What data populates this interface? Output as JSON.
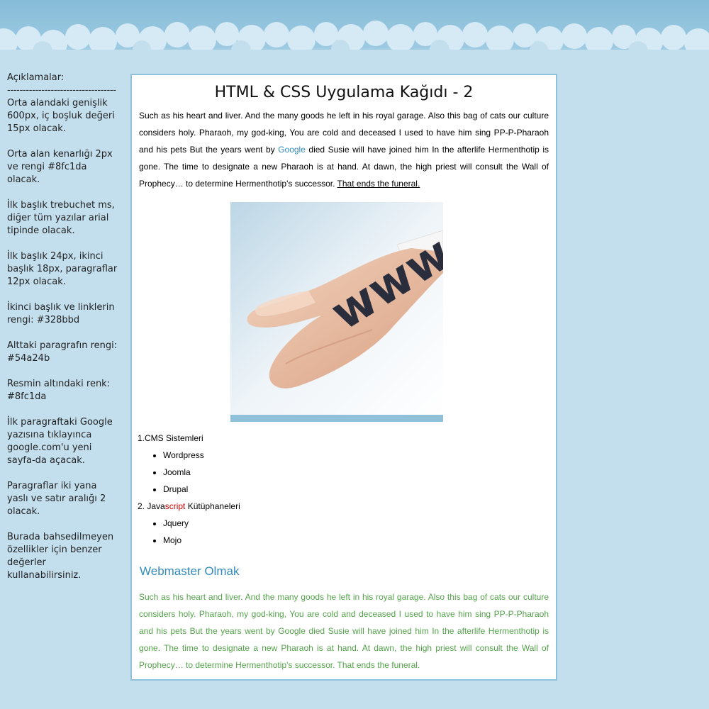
{
  "sidebar": {
    "heading": "Açıklamalar:",
    "divider": "-----------------------------------",
    "notes": [
      "Orta alandaki genişlik 600px, iç boşluk değeri 15px olacak.",
      "Orta alan kenarlığı 2px ve rengi #8fc1da olacak.",
      "İlk başlık trebuchet ms, diğer tüm yazılar arial tipinde olacak.",
      "İlk başlık 24px, ikinci başlık 18px, paragraflar 12px olacak.",
      "İkinci başlık ve linklerin rengi: #328bbd",
      "Alttaki paragrafın rengi: #54a24b",
      "Resmin altındaki renk: #8fc1da",
      "İlk paragraftaki Google yazısına tıklayınca google.com'u yeni sayfa-da açacak.",
      "Paragraflar iki yana yaslı ve satır aralığı 2 olacak.",
      "Burada bahsedilmeyen özellikler için benzer değerler kullanabilirsiniz."
    ]
  },
  "main": {
    "title": "HTML & CSS Uygulama Kağıdı - 2",
    "para1": {
      "text_a": "Such as his heart and liver. And the many goods he left in his royal garage. Also this bag of cats our culture considers holy. Pharaoh, my god-king, You are cold and deceased I used to have him sing PP-P-Pharaoh and his pets But the years went by ",
      "link_google": "Google",
      "text_b": " died Susie will have joined him In the afterlife Hermenthotip is gone. The time to designate a new Pharaoh is at hand. At dawn, the high priest will consult the Wall of Prophecy… to determine Hermenthotip's successor. ",
      "link_end": "That ends the funeral."
    },
    "image_text": "www",
    "lists": {
      "cms": {
        "title": "1.CMS Sistemleri",
        "items": [
          "Wordpress",
          "Joomla",
          "Drupal"
        ]
      },
      "js": {
        "title_a": "2. Java",
        "title_red": "script",
        "title_b": " Kütüphaneleri",
        "items": [
          "Jquery",
          "Mojo"
        ]
      }
    },
    "section_title": "Webmaster Olmak",
    "para2": "Such as his heart and liver. And the many goods he left in his royal garage. Also this bag of cats our culture considers holy. Pharaoh, my god-king, You are cold and deceased I used to have him sing PP-P-Pharaoh and his pets But the years went by Google died Susie will have joined him In the afterlife Hermenthotip is gone. The time to designate a new Pharaoh is at hand. At dawn, the high priest will consult the Wall of Prophecy… to determine Hermenthotip's successor. That ends the funeral."
  },
  "colors": {
    "border": "#8fc1da",
    "link": "#328bbd",
    "bottom_paragraph": "#54a24b",
    "page_bg": "#c3dfee",
    "red_word": "#d00000"
  }
}
